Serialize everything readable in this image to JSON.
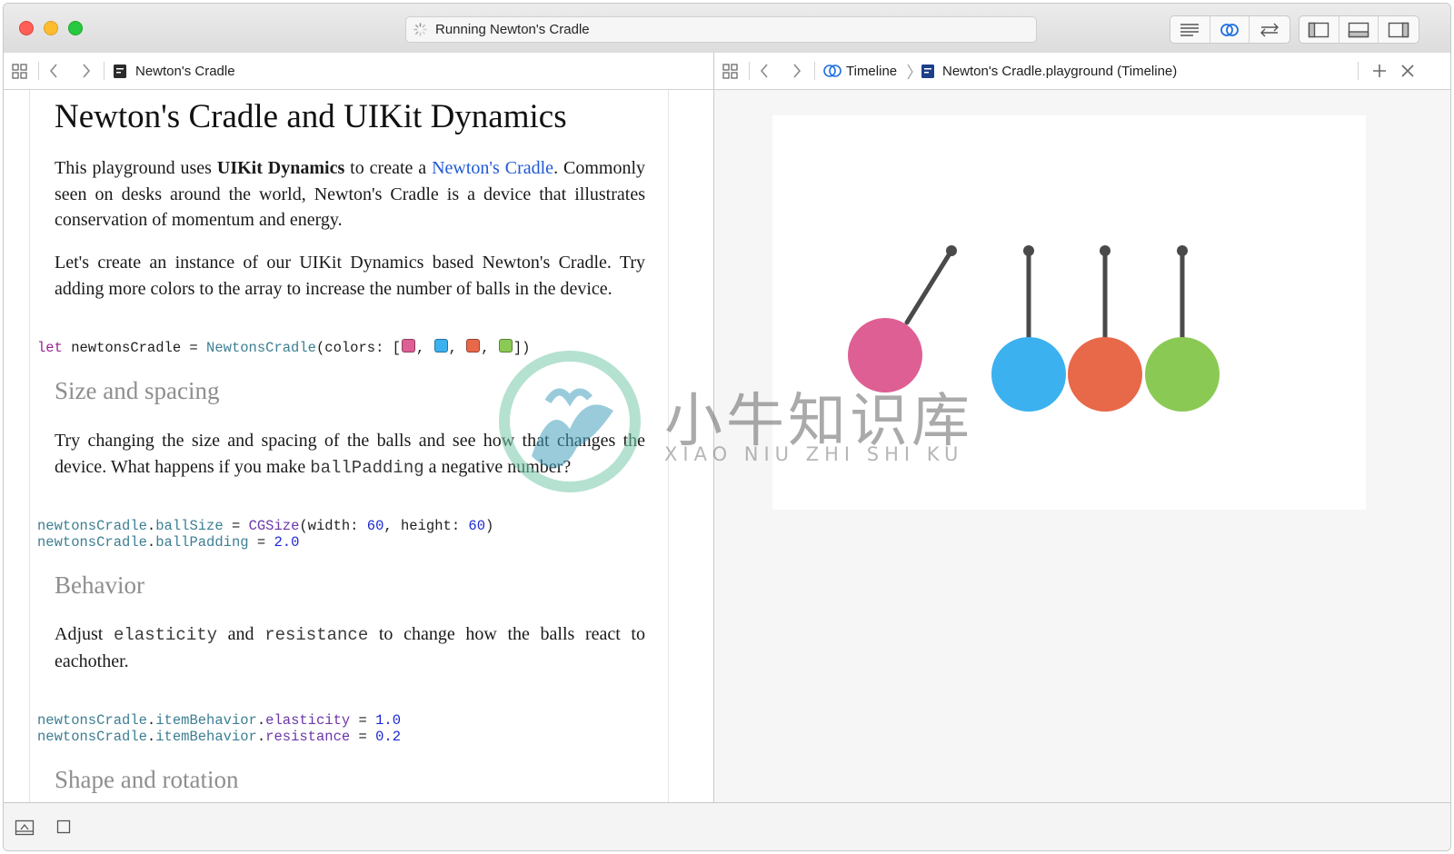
{
  "window": {
    "activity_title": "Running Newton's Cradle"
  },
  "left_jumpbar": {
    "file_name": "Newton's Cradle"
  },
  "right_jumpbar": {
    "timeline_label": "Timeline",
    "file_name": "Newton's Cradle.playground (Timeline)"
  },
  "doc": {
    "title": "Newton's Cradle and UIKit Dynamics",
    "intro": {
      "part1": "This playground uses ",
      "bold": "UIKit Dynamics",
      "part2": " to create a ",
      "link": "Newton's Cradle",
      "part3": ". Commonly seen on desks around the world, Newton's Cradle is a device that illustrates conservation of momentum and energy."
    },
    "para2": "Let's create an instance of our UIKit Dynamics based Newton's Cradle. Try adding more colors to the array to increase the number of balls in the device.",
    "code1": {
      "kw": "let",
      "var": " newtonsCradle = ",
      "type": "NewtonsCradle",
      "args_open": "(colors: [",
      "sep": ", ",
      "args_close": "])",
      "swatches": [
        "#de5f94",
        "#3bb1f0",
        "#e8684a",
        "#8bc955"
      ]
    },
    "h_size": "Size and spacing",
    "size_para": {
      "part1": "Try changing the size and spacing of the balls and see how that changes the device. What happens if you make ",
      "code": "ballPadding",
      "part2": " a negative number?"
    },
    "code2": {
      "l1_obj": "newtonsCradle",
      "l1_dot": ".",
      "l1_prop": "ballSize",
      "l1_eq": " = ",
      "l1_type": "CGSize",
      "l1_a": "(width: ",
      "l1_w": "60",
      "l1_b": ", height: ",
      "l1_h": "60",
      "l1_c": ")",
      "l2_obj": "newtonsCradle",
      "l2_dot": ".",
      "l2_prop": "ballPadding",
      "l2_eq": " = ",
      "l2_val": "2.0"
    },
    "h_behavior": "Behavior",
    "behavior_para": {
      "part1": "Adjust ",
      "code1": "elasticity",
      "part2": " and ",
      "code2": "resistance",
      "part3": " to change how the balls react to eachother."
    },
    "code3": {
      "obj": "newtonsCradle",
      "dot": ".",
      "mid": "itemBehavior",
      "l1_prop": "elasticity",
      "eq": " = ",
      "l1_val": "1.0",
      "l2_prop": "resistance",
      "l2_val": "0.2"
    },
    "h_shape": "Shape and rotation"
  },
  "cradle": {
    "balls": [
      {
        "color": "#de5f94",
        "state": "swung"
      },
      {
        "color": "#3bb1f0",
        "state": "rest"
      },
      {
        "color": "#e8684a",
        "state": "rest"
      },
      {
        "color": "#8bc955",
        "state": "rest"
      }
    ],
    "string_color": "#4a4a4a"
  },
  "watermark": {
    "cn": "小牛知识库",
    "pinyin": "XIAO NIU ZHI SHI KU"
  }
}
